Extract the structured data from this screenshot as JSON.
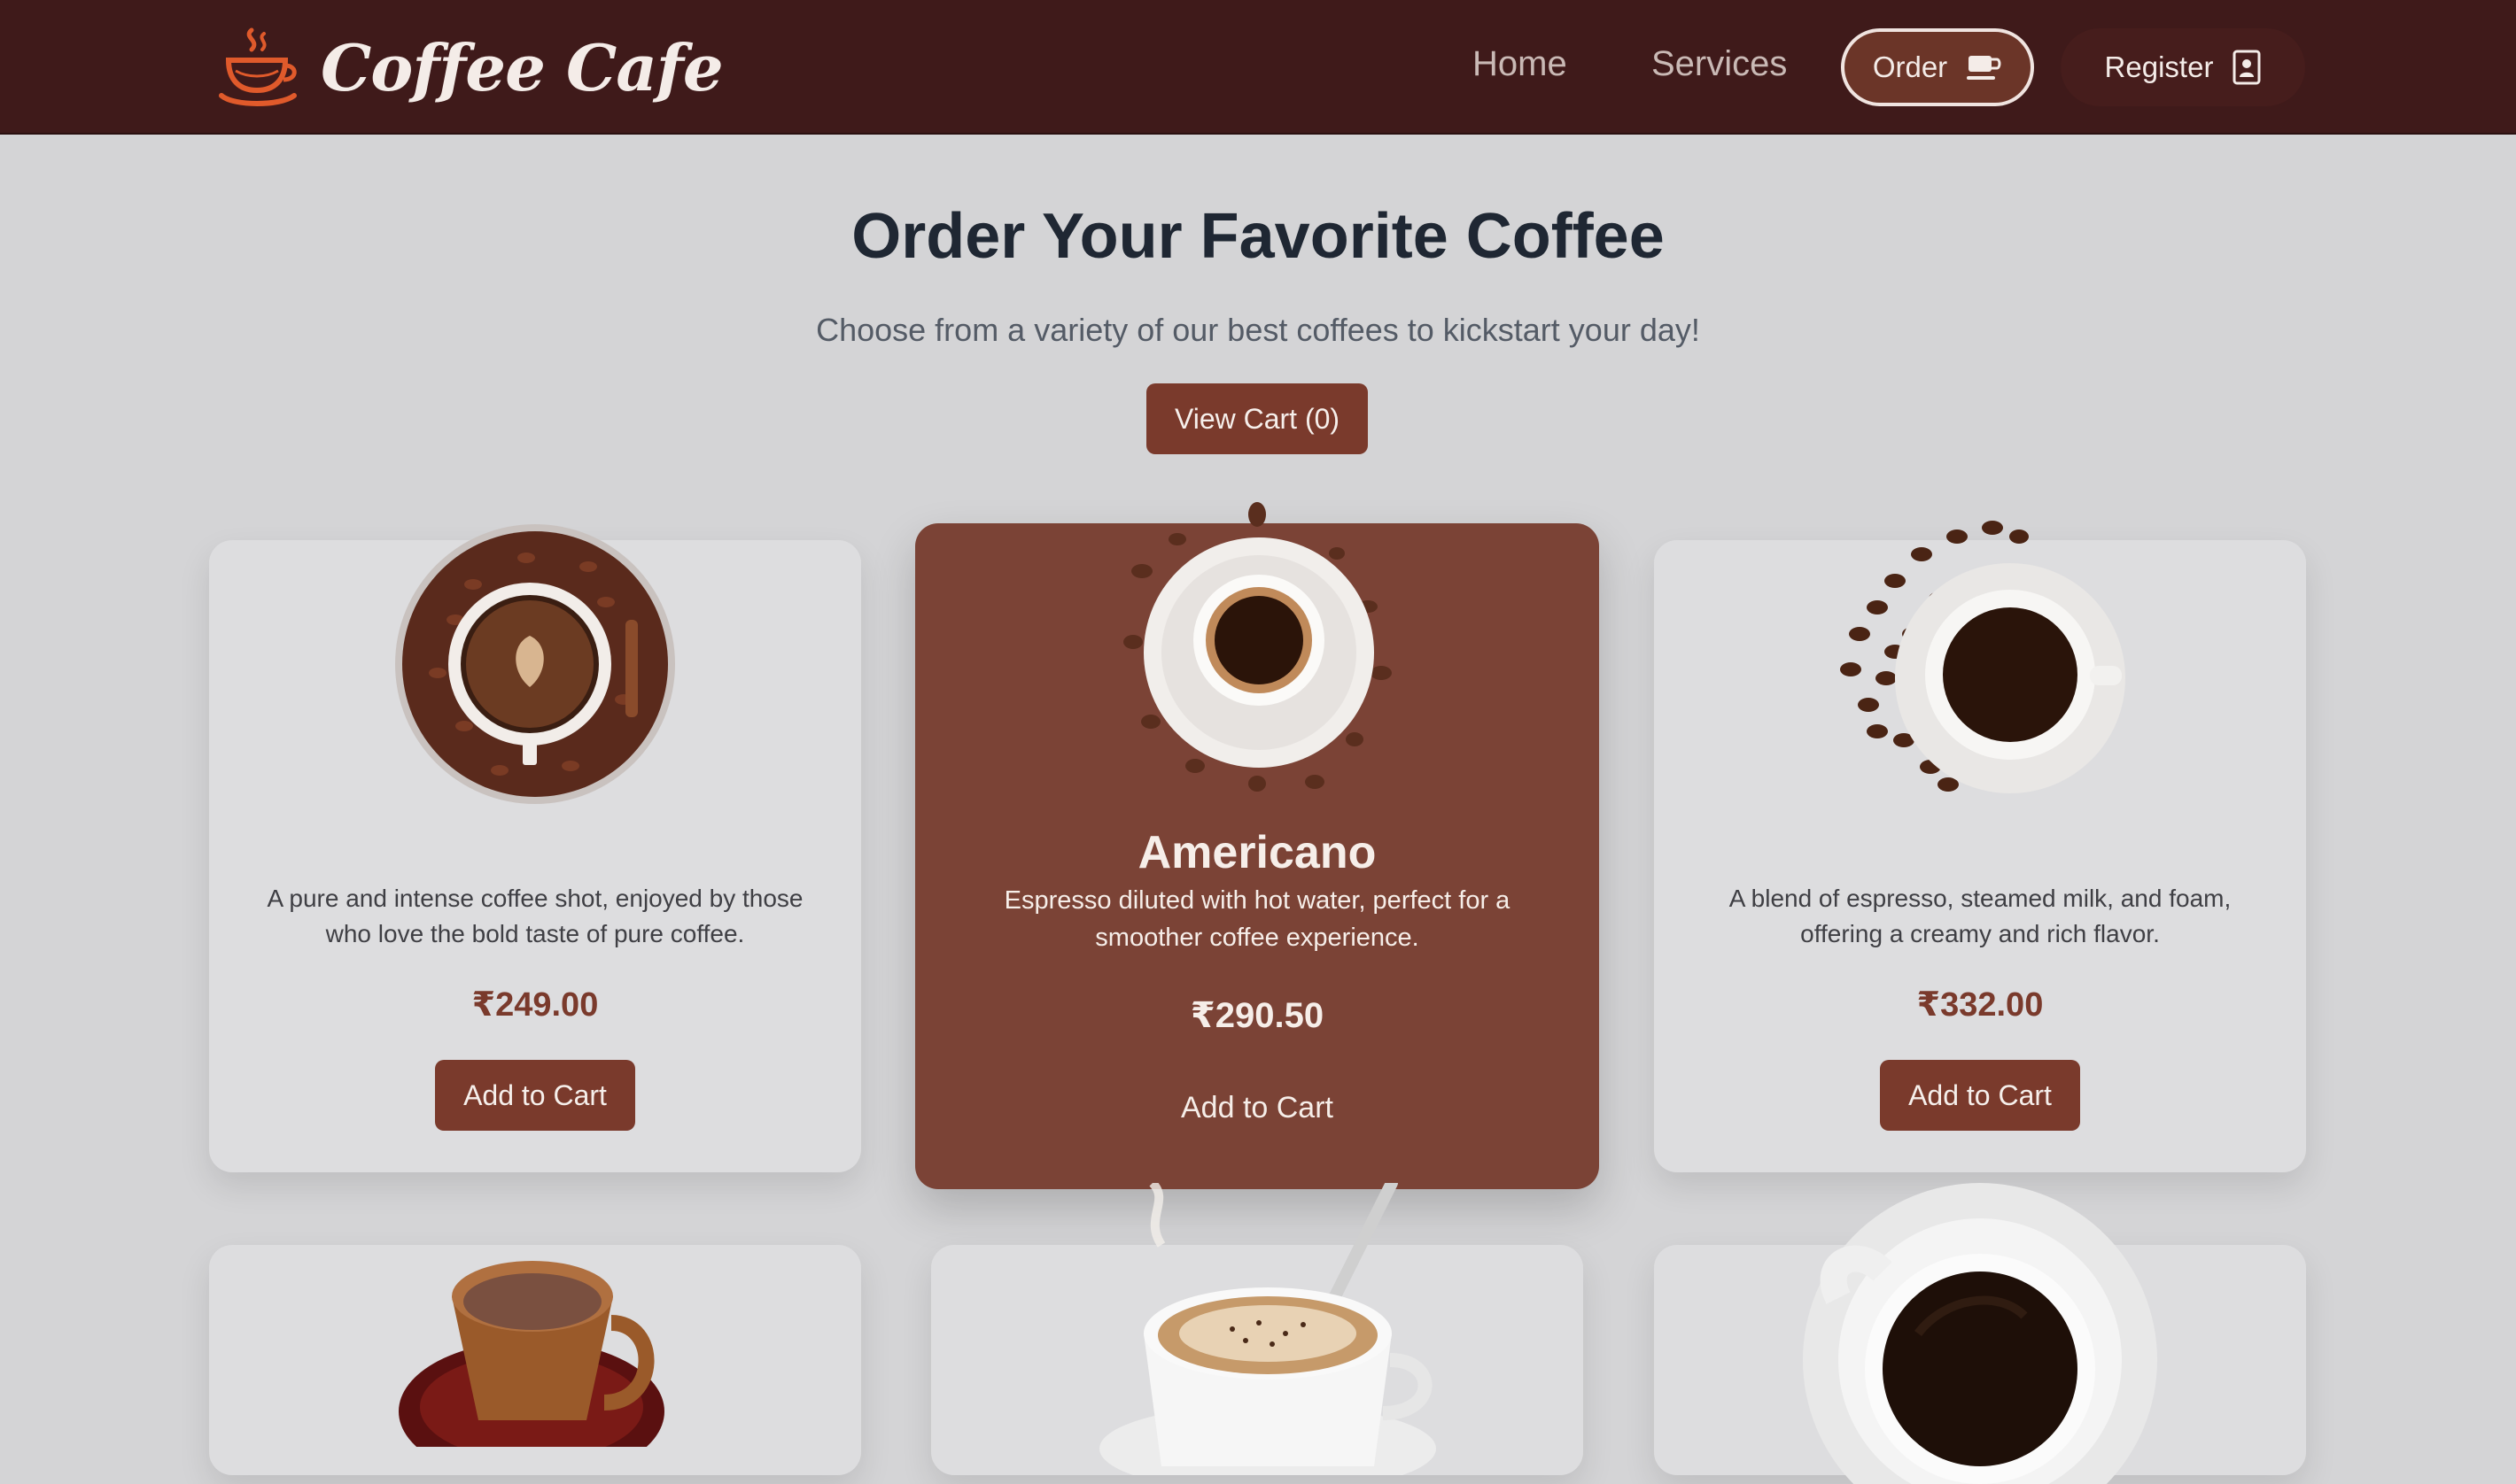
{
  "brand": {
    "name": "Coffee Cafe",
    "logo_icon": "coffee-cup-icon"
  },
  "nav": {
    "home": "Home",
    "services": "Services",
    "order": "Order",
    "order_icon": "coffee-mug-icon",
    "register": "Register",
    "register_icon": "id-badge-icon"
  },
  "hero": {
    "title": "Order Your Favorite Coffee",
    "subtitle": "Choose from a variety of our best coffees to kickstart your day!",
    "view_cart_label": "View Cart (0)"
  },
  "products": [
    {
      "name": "",
      "description": "A pure and intense coffee shot, enjoyed by those who love the bold taste of pure coffee.",
      "price": "₹249.00",
      "button": "Add to Cart"
    },
    {
      "name": "Americano",
      "description": "Espresso diluted with hot water, perfect for a smoother coffee experience.",
      "price": "₹290.50",
      "button": "Add to Cart"
    },
    {
      "name": "",
      "description": "A blend of espresso, steamed milk, and foam, offering a creamy and rich flavor.",
      "price": "₹332.00",
      "button": "Add to Cart"
    }
  ],
  "colors": {
    "nav_bg": "#3f1a1a",
    "accent": "#7a3a2c",
    "highlight_card": "#7b4336",
    "page_bg": "#d4d4d6"
  }
}
